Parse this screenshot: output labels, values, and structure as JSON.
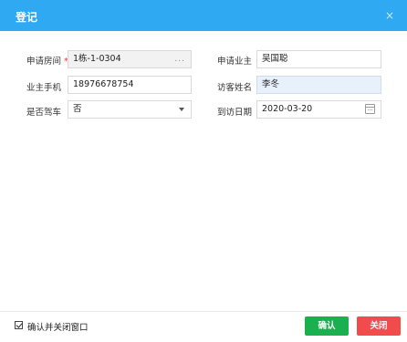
{
  "dialog": {
    "title": "登记",
    "close_glyph": "×"
  },
  "form": {
    "room": {
      "label": "申请房间",
      "required_mark": "*",
      "value": "1栋-1-0304",
      "more_glyph": "..."
    },
    "owner": {
      "label": "申请业主",
      "value": "吴国聪"
    },
    "owner_phone": {
      "label": "业主手机",
      "value": "18976678754"
    },
    "visitor_name": {
      "label": "访客姓名",
      "value": "李冬"
    },
    "driving": {
      "label": "是否驾车",
      "value": "否"
    },
    "visit_date": {
      "label": "到访日期",
      "value": "2020-03-20"
    }
  },
  "footer": {
    "checkbox_label": "确认并关闭窗口",
    "checkbox_checked": true,
    "confirm_label": "确认",
    "close_label": "关闭"
  },
  "colors": {
    "titlebar": "#2ea9f2",
    "confirm": "#1ab04f",
    "close": "#f14b4b",
    "required": "#e33333"
  }
}
